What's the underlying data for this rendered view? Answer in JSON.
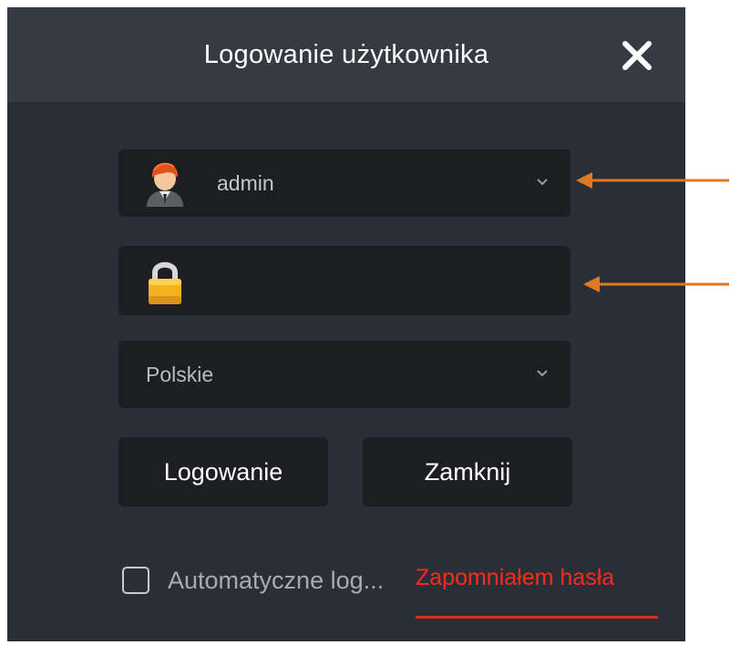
{
  "dialog": {
    "title": "Logowanie użytkownika",
    "close_icon": "close-icon"
  },
  "user_select": {
    "value": "admin",
    "icon": "user-avatar-icon",
    "chevron": "chevron-down-icon"
  },
  "password_field": {
    "value": "",
    "icon": "lock-icon"
  },
  "language_select": {
    "value": "Polskie",
    "chevron": "chevron-down-icon"
  },
  "buttons": {
    "login": "Logowanie",
    "close": "Zamknij"
  },
  "auto_login": {
    "label": "Automatyczne log...",
    "checked": false
  },
  "forgot_password": {
    "label": "Zapomniałem hasła"
  },
  "annotations": {
    "arrow_color": "#e07820",
    "highlight_color": "#ff2a1a"
  }
}
